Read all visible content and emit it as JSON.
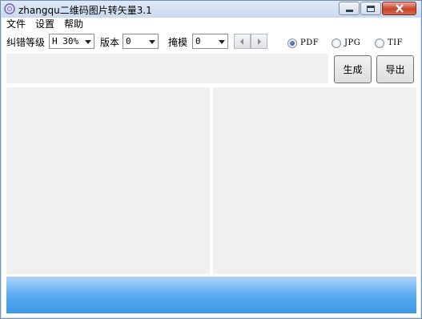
{
  "window": {
    "title": "zhangqu二维码图片转矢量3.1"
  },
  "menu": {
    "items": [
      "文件",
      "设置",
      "帮助"
    ]
  },
  "toolbar": {
    "error_level_label": "纠错等级",
    "error_level_value": "H 30%",
    "version_label": "版本",
    "version_value": "0",
    "mask_label": "掩模",
    "mask_value": "0"
  },
  "output_format": {
    "options": [
      "PDF",
      "JPG",
      "TIF"
    ],
    "selected": "PDF"
  },
  "actions": {
    "generate_label": "生成",
    "export_label": "导出"
  },
  "colors": {
    "bottom_bar_top": "#aed4fb",
    "bottom_bar_bottom": "#3d97e6",
    "close_button": "#c7432a"
  }
}
